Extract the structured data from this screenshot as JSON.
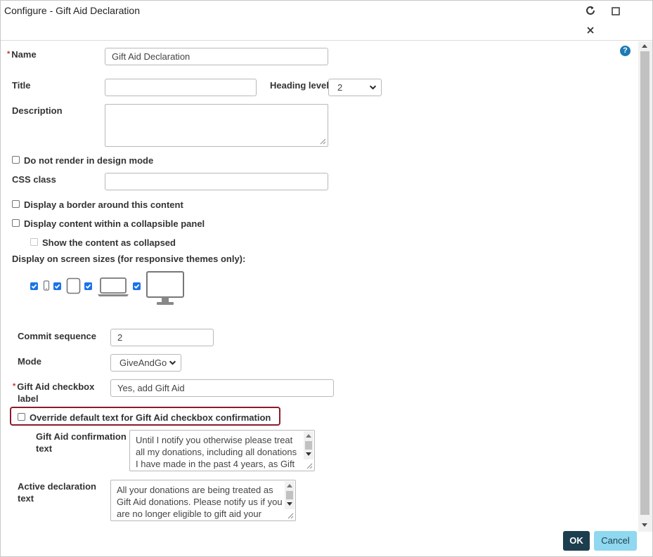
{
  "window": {
    "title": "Configure - Gift Aid Declaration",
    "refresh_icon": "refresh-icon",
    "maximize_icon": "maximize-icon",
    "close_icon": "close-icon"
  },
  "form": {
    "name": {
      "label": "Name",
      "value": "Gift Aid Declaration",
      "required": true
    },
    "title": {
      "label": "Title",
      "value": ""
    },
    "heading_level": {
      "label": "Heading level",
      "value": "2"
    },
    "description": {
      "label": "Description",
      "value": ""
    },
    "do_not_render": {
      "label": "Do not render in design mode",
      "checked": false
    },
    "css_class": {
      "label": "CSS class",
      "value": ""
    },
    "display_border": {
      "label": "Display a border around this content",
      "checked": false
    },
    "collapsible_panel": {
      "label": "Display content within a collapsible panel",
      "checked": false
    },
    "show_collapsed": {
      "label": "Show the content as collapsed",
      "checked": false,
      "disabled": true
    },
    "screen_sizes": {
      "label": "Display on screen sizes (for responsive themes only):",
      "devices": [
        {
          "name": "phone",
          "checked": true
        },
        {
          "name": "tablet",
          "checked": true
        },
        {
          "name": "laptop",
          "checked": true
        },
        {
          "name": "desktop",
          "checked": true
        }
      ]
    },
    "commit_sequence": {
      "label": "Commit sequence",
      "value": "2"
    },
    "mode": {
      "label": "Mode",
      "value": "GiveAndGo"
    },
    "gift_aid_checkbox_label": {
      "label_line1": "Gift Aid checkbox",
      "label_line2": "label",
      "value": "Yes, add Gift Aid",
      "required": true
    },
    "override_default": {
      "label": "Override default text for Gift Aid checkbox confirmation",
      "checked": false
    },
    "confirmation_text": {
      "label_line1": "Gift Aid confirmation",
      "label_line2": "text",
      "lines": [
        "Until I notify you otherwise please treat",
        "all my donations, including all donations",
        "I have made in the past 4 years, as Gift"
      ]
    },
    "active_declaration": {
      "label_line1": "Active declaration",
      "label_line2": "text",
      "lines": [
        "All your donations are being treated as",
        "Gift Aid donations. Please notify us if you",
        "are no longer eligible to gift aid your"
      ]
    }
  },
  "help": {
    "icon": "help-icon",
    "glyph": "?"
  },
  "footer": {
    "ok_label": "OK",
    "cancel_label": "Cancel"
  },
  "colors": {
    "accent": "#1d3e4f",
    "cancel_bg": "#8fd8ef",
    "highlight": "#8b1a2b",
    "required": "#c0392b",
    "help": "#1c7ab5"
  }
}
